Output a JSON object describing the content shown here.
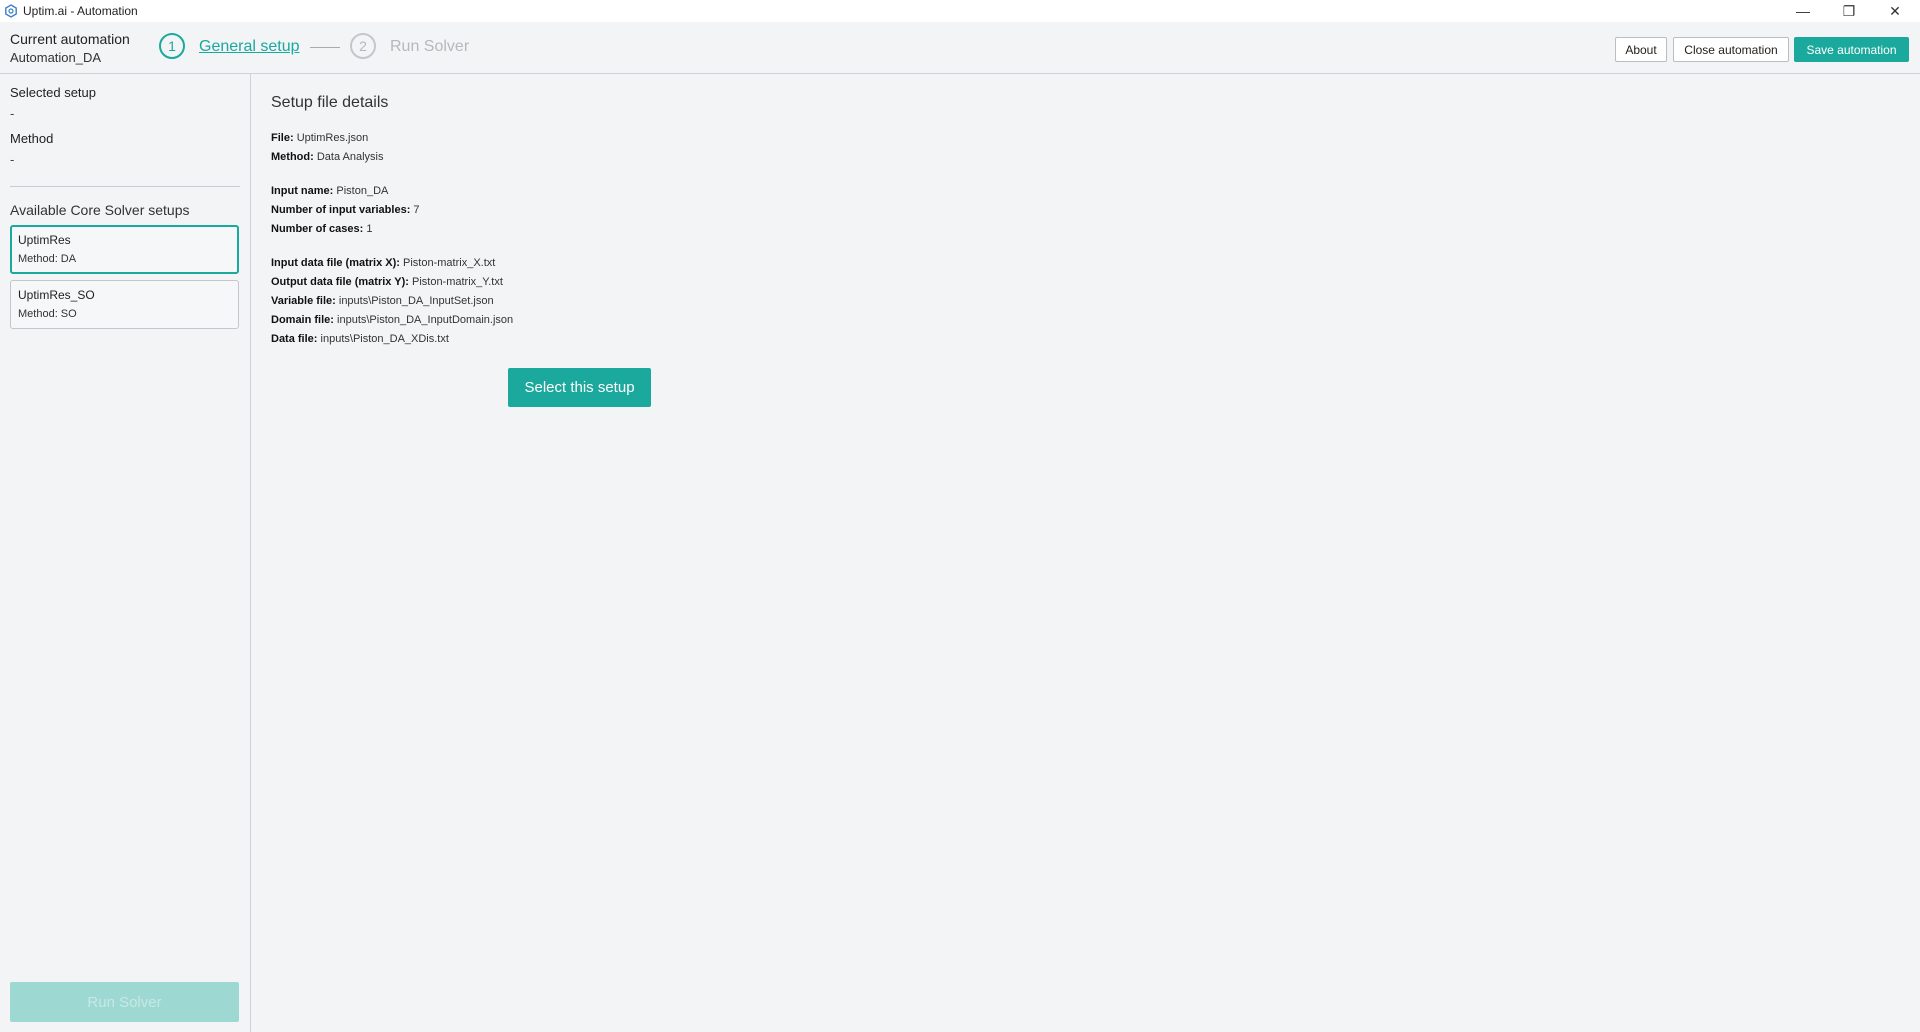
{
  "window": {
    "title": "Uptim.ai - Automation",
    "minimize_glyph": "—",
    "restore_glyph": "❐",
    "close_glyph": "✕"
  },
  "header": {
    "current_automation_label": "Current automation",
    "current_automation_value": "Automation_DA",
    "steps": [
      {
        "number": "1",
        "label": "General setup"
      },
      {
        "number": "2",
        "label": "Run Solver"
      }
    ],
    "about_label": "About",
    "close_label": "Close automation",
    "save_label": "Save automation"
  },
  "sidebar": {
    "selected_setup_label": "Selected setup",
    "selected_setup_value": "-",
    "method_label": "Method",
    "method_value": "-",
    "available_label": "Available Core Solver setups",
    "setups": [
      {
        "name": "UptimRes",
        "method": "Method: DA"
      },
      {
        "name": "UptimRes_SO",
        "method": "Method: SO"
      }
    ],
    "run_solver_label": "Run Solver"
  },
  "main": {
    "title": "Setup file details",
    "details": [
      {
        "key": "File:",
        "value": "UptimRes.json"
      },
      {
        "key": "Method:",
        "value": "Data Analysis"
      },
      {
        "key": "Input name:",
        "value": "Piston_DA"
      },
      {
        "key": "Number of input variables:",
        "value": "7"
      },
      {
        "key": "Number of cases:",
        "value": "1"
      },
      {
        "key": "Input data file (matrix X):",
        "value": "Piston-matrix_X.txt"
      },
      {
        "key": "Output data file (matrix Y):",
        "value": "Piston-matrix_Y.txt"
      },
      {
        "key": "Variable file:",
        "value": "inputs\\Piston_DA_InputSet.json"
      },
      {
        "key": "Domain file:",
        "value": "inputs\\Piston_DA_InputDomain.json"
      },
      {
        "key": "Data file:",
        "value": "inputs\\Piston_DA_XDis.txt"
      }
    ],
    "select_button_label": "Select this setup"
  },
  "colors": {
    "accent": "#1aa99c",
    "accent_disabled": "#9ed8d2",
    "background": "#f2f4f6"
  },
  "icons": {
    "app": "hexagon-logo-icon"
  }
}
